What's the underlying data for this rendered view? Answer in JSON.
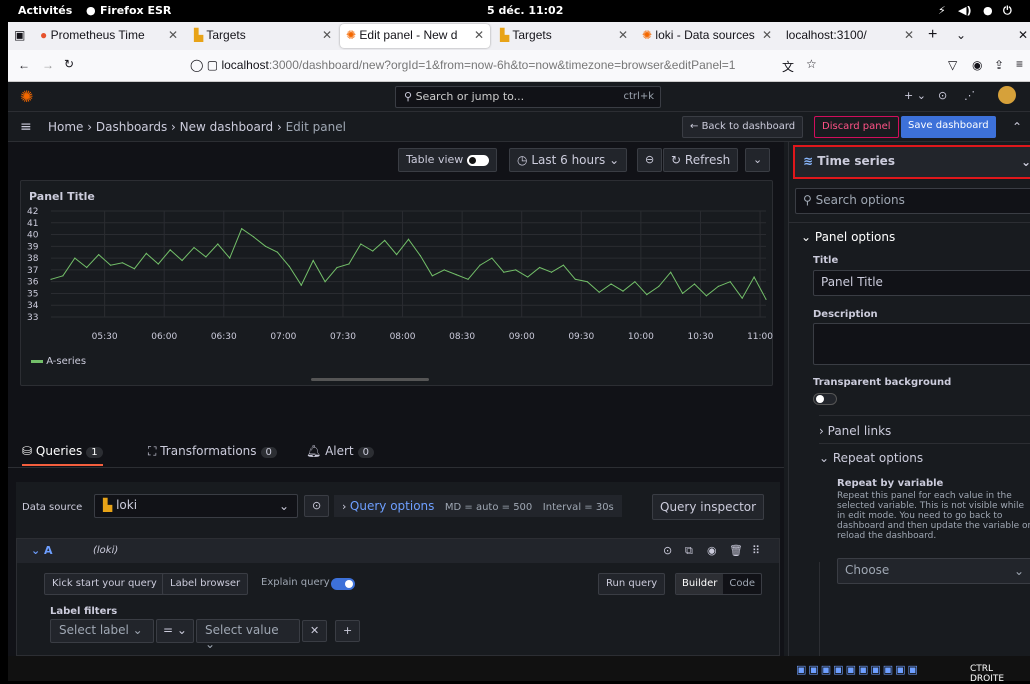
{
  "gnome": {
    "activities": "Activités",
    "app": "Firefox ESR",
    "clock": "5 déc. 11:02"
  },
  "browser": {
    "tabs": [
      {
        "label": "Prometheus Time",
        "active": false
      },
      {
        "label": "Targets",
        "active": false
      },
      {
        "label": "Edit panel - New d",
        "active": true
      },
      {
        "label": "Targets",
        "active": false
      },
      {
        "label": "loki - Data sources",
        "active": false
      },
      {
        "label": "localhost:3100/",
        "active": false
      }
    ],
    "url_host": "localhost",
    "url_rest": ":3000/dashboard/new?orgId=1&from=now-6h&to=now&timezone=browser&editPanel=1"
  },
  "topnav": {
    "search_placeholder": "Search or jump to...",
    "shortcut": "ctrl+k"
  },
  "breadcrumb": [
    "Home",
    "Dashboards",
    "New dashboard",
    "Edit panel"
  ],
  "actions": {
    "back": "Back to dashboard",
    "discard": "Discard panel",
    "save": "Save dashboard"
  },
  "toolbar": {
    "table_view": "Table view",
    "time_range": "Last 6 hours",
    "refresh": "Refresh"
  },
  "panel": {
    "title": "Panel Title",
    "legend": "A-series"
  },
  "chart_data": {
    "type": "line",
    "title": "Panel Title",
    "y_ticks": [
      "42",
      "41",
      "40",
      "39",
      "38",
      "37",
      "36",
      "35",
      "34",
      "33"
    ],
    "x_ticks": [
      "05:30",
      "06:00",
      "06:30",
      "07:00",
      "07:30",
      "08:00",
      "08:30",
      "09:00",
      "09:30",
      "10:00",
      "10:30",
      "11:00"
    ],
    "ylim": [
      33,
      42
    ],
    "xlim": [
      5.05,
      11.05
    ],
    "series": [
      {
        "name": "A-series",
        "color": "#73bf69",
        "x": [
          5.05,
          5.15,
          5.25,
          5.35,
          5.45,
          5.55,
          5.65,
          5.75,
          5.85,
          5.95,
          6.05,
          6.15,
          6.25,
          6.35,
          6.45,
          6.55,
          6.65,
          6.75,
          6.85,
          6.95,
          7.05,
          7.15,
          7.25,
          7.35,
          7.45,
          7.55,
          7.65,
          7.75,
          7.85,
          7.95,
          8.05,
          8.15,
          8.25,
          8.35,
          8.45,
          8.55,
          8.65,
          8.75,
          8.85,
          8.95,
          9.05,
          9.15,
          9.25,
          9.35,
          9.45,
          9.55,
          9.65,
          9.75,
          9.85,
          9.95,
          10.05,
          10.15,
          10.25,
          10.35,
          10.45,
          10.55,
          10.65,
          10.75,
          10.85,
          10.95,
          11.05
        ],
        "y": [
          36.2,
          36.5,
          38.0,
          37.2,
          38.3,
          37.4,
          37.6,
          37.1,
          38.4,
          37.5,
          38.7,
          37.8,
          38.9,
          38.1,
          39.2,
          38.0,
          40.5,
          39.8,
          39.0,
          38.5,
          37.3,
          35.7,
          37.8,
          36.0,
          37.2,
          37.5,
          39.2,
          38.6,
          39.5,
          38.3,
          39.6,
          38.2,
          36.5,
          37.0,
          36.6,
          36.2,
          37.4,
          38.0,
          36.8,
          37.0,
          36.4,
          37.2,
          36.8,
          37.4,
          36.2,
          36.0,
          35.1,
          35.8,
          35.2,
          36.0,
          34.9,
          35.6,
          36.8,
          35.0,
          35.8,
          34.8,
          35.6,
          36.0,
          34.6,
          36.4,
          34.5
        ]
      }
    ],
    "grid": true,
    "legend": "bottom-left"
  },
  "queries": {
    "tabs": [
      {
        "label": "Queries",
        "count": "1"
      },
      {
        "label": "Transformations",
        "count": "0"
      },
      {
        "label": "Alert",
        "count": "0"
      }
    ],
    "datasource_label": "Data source",
    "datasource": "loki",
    "query_options": "Query options",
    "md": "MD = auto = 500",
    "interval": "Interval = 30s",
    "inspector": "Query inspector",
    "row_letter": "A",
    "row_ds": "(loki)",
    "kick_start": "Kick start your query",
    "label_browser": "Label browser",
    "explain": "Explain query",
    "run": "Run query",
    "builder": "Builder",
    "code": "Code",
    "label_filters": "Label filters",
    "select_label": "Select label",
    "op": "=",
    "select_value": "Select value"
  },
  "options": {
    "viz": "Time series",
    "search_placeholder": "Search options",
    "panel_options": "Panel options",
    "title_label": "Title",
    "title_value": "Panel Title",
    "description_label": "Description",
    "transparent_label": "Transparent background",
    "panel_links": "Panel links",
    "repeat_options": "Repeat options",
    "repeat_by": "Repeat by variable",
    "repeat_help": "Repeat this panel for each value in the selected variable. This is not visible while in edit mode. You need to go back to dashboard and then update the variable or reload the dashboard.",
    "choose": "Choose"
  },
  "taskbar": {
    "label": "CTRL DROITE"
  }
}
